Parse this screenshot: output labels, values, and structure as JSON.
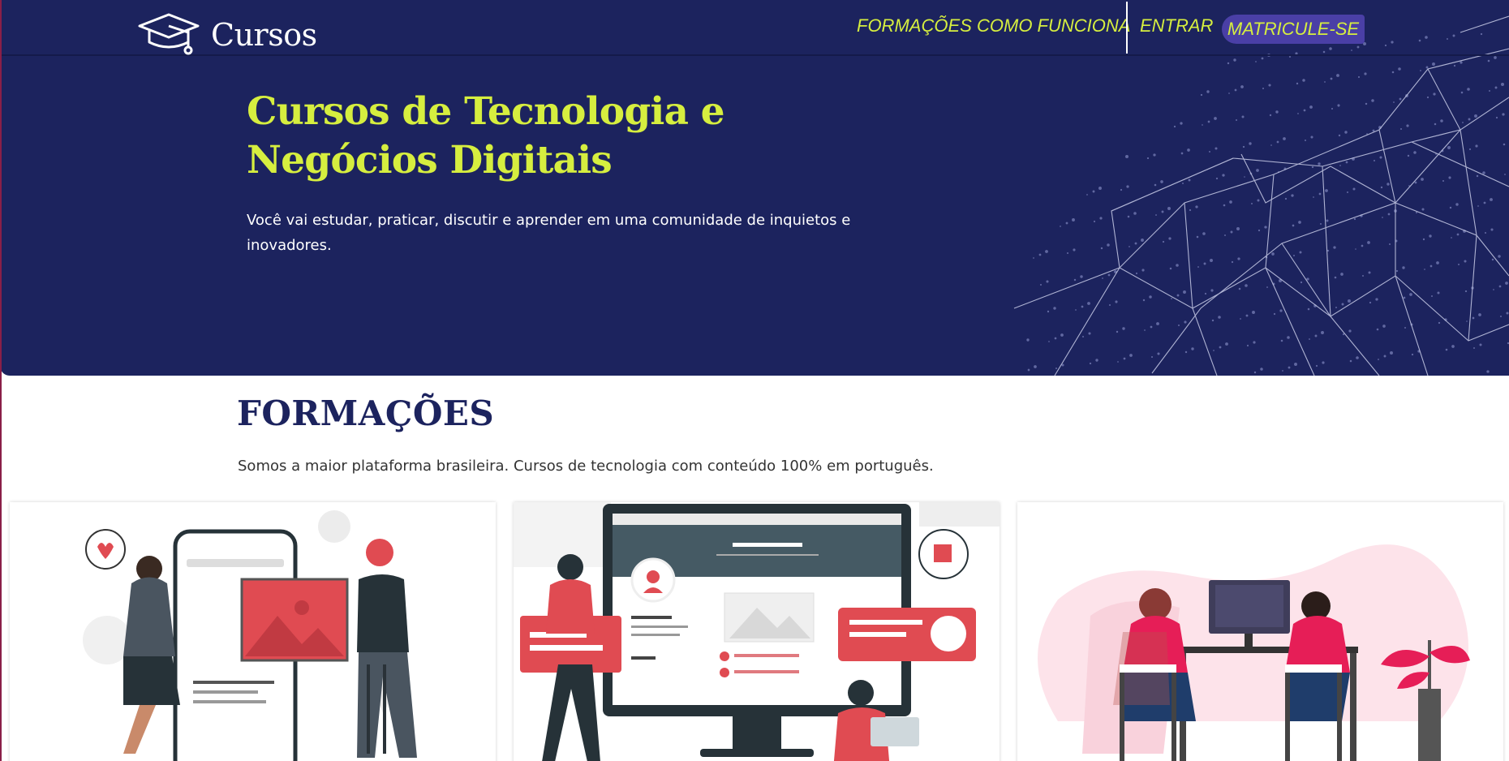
{
  "header": {
    "brand": "Cursos",
    "logo_icon": "graduation-cap-icon",
    "nav": [
      {
        "label": "FORMAÇÕES"
      },
      {
        "label": "COMO FUNCIONA"
      },
      {
        "label": "ENTRAR"
      }
    ],
    "cta_label": "MATRICULE-SE"
  },
  "hero": {
    "title_line1": "Cursos de Tecnologia e",
    "title_line2": "Negócios Digitais",
    "subtitle_line1": "Você vai estudar, praticar, discutir e aprender em uma comunidade de inquietos e",
    "subtitle_line2": "inovadores."
  },
  "formacoes": {
    "title": "FORMAÇÕES",
    "description": "Somos a maior plataforma brasileira. Cursos de tecnologia com conteúdo 100% em português.",
    "cards": [
      {
        "illustration": "social-media-illustration"
      },
      {
        "illustration": "web-profile-illustration"
      },
      {
        "illustration": "teamwork-computer-illustration"
      }
    ]
  },
  "colors": {
    "hero_bg": "#1c235e",
    "accent": "#d6ee3f",
    "cta_bg": "#4a3fa6",
    "section_title": "#1c235e",
    "illustration_red": "#e04b52"
  }
}
